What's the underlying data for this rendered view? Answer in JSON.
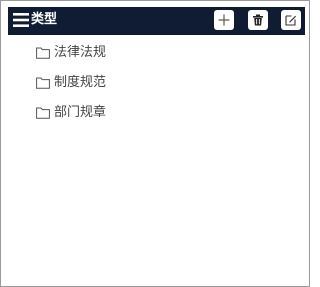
{
  "header": {
    "title": "类型",
    "menu_icon": "hamburger-menu-icon",
    "buttons": [
      {
        "name": "add",
        "icon": "plus-icon"
      },
      {
        "name": "delete",
        "icon": "trash-icon"
      },
      {
        "name": "edit",
        "icon": "edit-icon"
      }
    ]
  },
  "tree": {
    "items": [
      {
        "label": "法律法规",
        "icon": "folder-icon"
      },
      {
        "label": "制度规范",
        "icon": "folder-icon"
      },
      {
        "label": "部门规章",
        "icon": "folder-icon"
      }
    ]
  },
  "colors": {
    "header_bg": "#0f1c33",
    "text": "#444444",
    "border": "#9a9a9a"
  }
}
